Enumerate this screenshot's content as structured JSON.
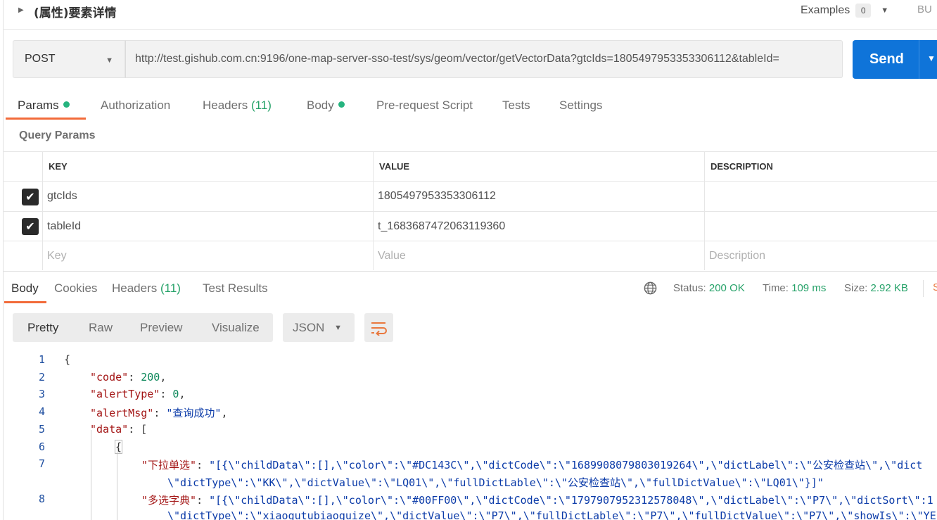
{
  "request": {
    "name": "(属性)要素详情",
    "examples_label": "Examples",
    "examples_count": "0",
    "bulk_label": "BU",
    "method": "POST",
    "url": "http://test.gishub.com.cn:9196/one-map-server-sso-test/sys/geom/vector/getVectorData?gtcIds=1805497953353306112&tableId=",
    "send_label": "Send"
  },
  "request_tabs": [
    {
      "label": "Params",
      "dot": true
    },
    {
      "label": "Authorization"
    },
    {
      "label": "Headers",
      "count": "(11)"
    },
    {
      "label": "Body",
      "dot": true
    },
    {
      "label": "Pre-request Script"
    },
    {
      "label": "Tests"
    },
    {
      "label": "Settings"
    }
  ],
  "query_params": {
    "title": "Query Params",
    "headers": {
      "key": "KEY",
      "value": "VALUE",
      "description": "DESCRIPTION"
    },
    "rows": [
      {
        "checked": true,
        "key": "gtcIds",
        "value": "1805497953353306112",
        "description": ""
      },
      {
        "checked": true,
        "key": "tableId",
        "value": "t_1683687472063119360",
        "description": ""
      }
    ],
    "placeholder": {
      "key": "Key",
      "value": "Value",
      "description": "Description"
    }
  },
  "response_tabs": [
    {
      "label": "Body"
    },
    {
      "label": "Cookies"
    },
    {
      "label": "Headers",
      "count": "(11)"
    },
    {
      "label": "Test Results"
    }
  ],
  "response_status": {
    "status_label": "Status:",
    "status_value": "200 OK",
    "time_label": "Time:",
    "time_value": "109 ms",
    "size_label": "Size:",
    "size_value": "2.92 KB",
    "more_label": "S"
  },
  "viewer": {
    "modes": [
      "Pretty",
      "Raw",
      "Preview",
      "Visualize"
    ],
    "format": "JSON"
  },
  "code_lines": {
    "l1": "1",
    "l2": "2",
    "l3": "3",
    "l4": "4",
    "l5": "5",
    "l6": "6",
    "l7": "7",
    "l8": "8",
    "brace_open": "{",
    "code_key": "\"code\"",
    "code_val": "200",
    "alert_type_key": "\"alertType\"",
    "alert_type_val": "0",
    "alert_msg_key": "\"alertMsg\"",
    "alert_msg_val": "\"查询成功\"",
    "data_key": "\"data\"",
    "data_open": "[",
    "obj_open": "{",
    "dropdown_key": "\"下拉单选\"",
    "dropdown_val_1": "\"[{\\\"childData\\\":[],\\\"color\\\":\\\"#DC143C\\\",\\\"dictCode\\\":\\\"1689908079803019264\\\",\\\"dictLabel\\\":\\\"公安检查站\\\",\\\"dict",
    "dropdown_val_2": "\\\"dictType\\\":\\\"KK\\\",\\\"dictValue\\\":\\\"LQ01\\\",\\\"fullDictLable\\\":\\\"公安检查站\\\",\\\"fullDictValue\\\":\\\"LQ01\\\"}]\"",
    "multi_key": "\"多选字典\"",
    "multi_val_1": "\"[{\\\"childData\\\":[],\\\"color\\\":\\\"#00FF00\\\",\\\"dictCode\\\":\\\"1797907952312578048\\\",\\\"dictLabel\\\":\\\"P7\\\",\\\"dictSort\\\":1",
    "multi_val_2": "\\\"dictType\\\":\\\"xiaogutubiaoguize\\\",\\\"dictValue\\\":\\\"P7\\\",\\\"fullDictLable\\\":\\\"P7\\\",\\\"fullDictValue\\\":\\\"P7\\\",\\\"showIs\\\":\\\"YE"
  }
}
